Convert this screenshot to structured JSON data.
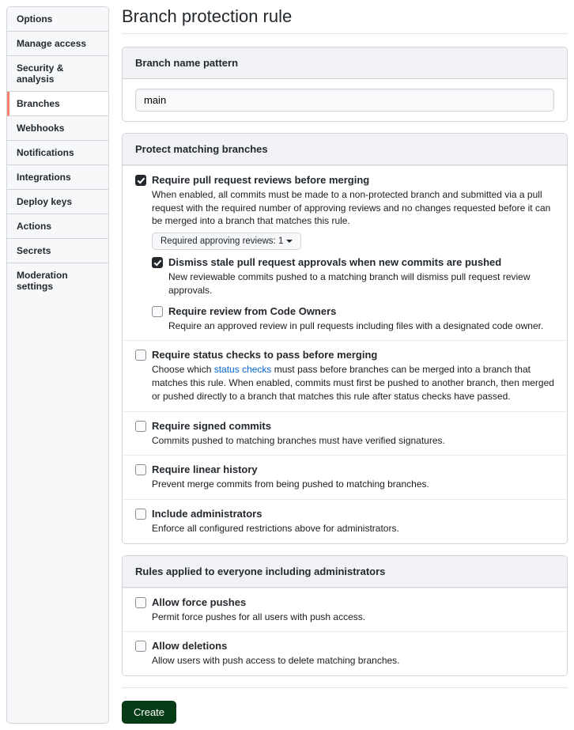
{
  "sidebar": {
    "items": [
      {
        "label": "Options"
      },
      {
        "label": "Manage access"
      },
      {
        "label": "Security & analysis"
      },
      {
        "label": "Branches",
        "active": true
      },
      {
        "label": "Webhooks"
      },
      {
        "label": "Notifications"
      },
      {
        "label": "Integrations"
      },
      {
        "label": "Deploy keys"
      },
      {
        "label": "Actions"
      },
      {
        "label": "Secrets"
      },
      {
        "label": "Moderation settings"
      }
    ]
  },
  "page": {
    "title": "Branch protection rule"
  },
  "pattern": {
    "heading": "Branch name pattern",
    "value": "main"
  },
  "protect": {
    "heading": "Protect matching branches"
  },
  "rules": {
    "requirePR": {
      "title": "Require pull request reviews before merging",
      "desc": "When enabled, all commits must be made to a non-protected branch and submitted via a pull request with the required number of approving reviews and no changes requested before it can be merged into a branch that matches this rule.",
      "dropdown": "Required approving reviews: 1"
    },
    "dismiss": {
      "title": "Dismiss stale pull request approvals when new commits are pushed",
      "desc": "New reviewable commits pushed to a matching branch will dismiss pull request review approvals."
    },
    "codeowners": {
      "title": "Require review from Code Owners",
      "desc": "Require an approved review in pull requests including files with a designated code owner."
    },
    "status": {
      "title": "Require status checks to pass before merging",
      "desc1": "Choose which ",
      "link": "status checks",
      "desc2": " must pass before branches can be merged into a branch that matches this rule. When enabled, commits must first be pushed to another branch, then merged or pushed directly to a branch that matches this rule after status checks have passed."
    },
    "signed": {
      "title": "Require signed commits",
      "desc": "Commits pushed to matching branches must have verified signatures."
    },
    "linear": {
      "title": "Require linear history",
      "desc": "Prevent merge commits from being pushed to matching branches."
    },
    "admins": {
      "title": "Include administrators",
      "desc": "Enforce all configured restrictions above for administrators."
    }
  },
  "everyone": {
    "heading": "Rules applied to everyone including administrators",
    "force": {
      "title": "Allow force pushes",
      "desc": "Permit force pushes for all users with push access."
    },
    "delete": {
      "title": "Allow deletions",
      "desc": "Allow users with push access to delete matching branches."
    }
  },
  "create": {
    "label": "Create"
  }
}
